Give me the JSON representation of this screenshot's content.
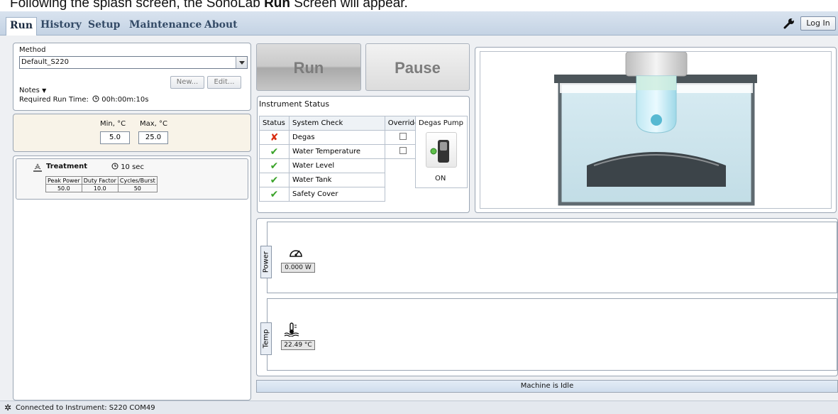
{
  "caption": {
    "prefix": "Following the splash screen, the SonoLab ",
    "bold": "Run",
    "suffix": " Screen will appear."
  },
  "menu": {
    "tabs": [
      "Run",
      "History",
      "Setup",
      "Maintenance",
      "About"
    ],
    "login": "Log In"
  },
  "method": {
    "label": "Method",
    "selected": "Default_S220",
    "new_label": "New...",
    "edit_label": "Edit...",
    "notes_label": "Notes",
    "required_label": "Required Run Time:",
    "required_value": "00h:00m:10s"
  },
  "temps": {
    "min_label": "Min, °C",
    "max_label": "Max, °C",
    "min_value": "5.0",
    "max_value": "25.0"
  },
  "treatment": {
    "label": "Treatment",
    "duration": "10 sec",
    "headers": [
      "Peak Power",
      "Duty Factor",
      "Cycles/Burst"
    ],
    "values": [
      "50.0",
      "10.0",
      "50"
    ]
  },
  "controls": {
    "run": "Run",
    "pause": "Pause"
  },
  "status": {
    "title": "Instrument Status",
    "headers": [
      "Status",
      "System Check",
      "Override"
    ],
    "rows": [
      {
        "ok": false,
        "check": "Degas",
        "override": true
      },
      {
        "ok": true,
        "check": "Water Temperature",
        "override": true
      },
      {
        "ok": true,
        "check": "Water Level",
        "override": false
      },
      {
        "ok": true,
        "check": "Water Tank",
        "override": false
      },
      {
        "ok": true,
        "check": "Safety Cover",
        "override": false
      }
    ],
    "degas_title": "Degas Pump",
    "degas_state": "ON"
  },
  "monitor": {
    "power_tab": "Power",
    "power_value": "0.000 W",
    "temp_tab": "Temp",
    "temp_value": "22.49 °C",
    "status_text": "Machine is Idle"
  },
  "statusbar": {
    "text": "Connected to Instrument: S220 COM49"
  },
  "colors": {
    "fail": "#d82b10",
    "ok": "#3aa32a",
    "accent": "#c4d3e4"
  }
}
